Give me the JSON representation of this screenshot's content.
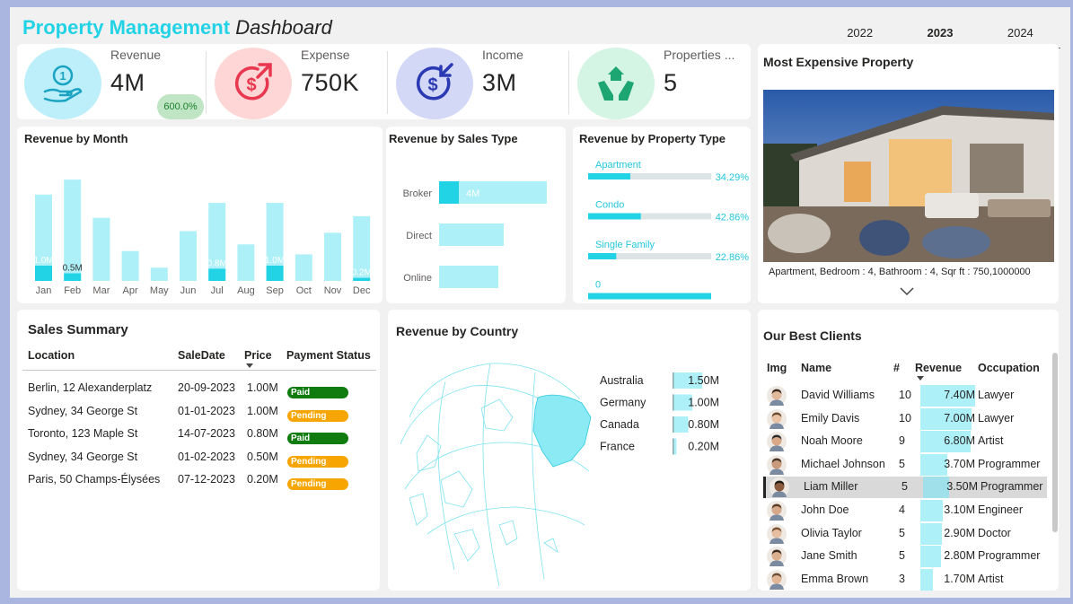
{
  "header": {
    "title_part1": "Property Management",
    "title_part2": "Dashboard"
  },
  "year_tabs": [
    {
      "label": "2022",
      "active": false
    },
    {
      "label": "2023",
      "active": true
    },
    {
      "label": "2024",
      "active": false
    }
  ],
  "kpis": {
    "revenue": {
      "label": "Revenue",
      "value": "4M",
      "badge": "600.0%",
      "icon": "hand-coin-icon",
      "color": "#bdeffa"
    },
    "expense": {
      "label": "Expense",
      "value": "750K",
      "icon": "dollar-arrow-out-icon",
      "color": "#ffd6d6"
    },
    "income": {
      "label": "Income",
      "value": "3M",
      "icon": "dollar-arrow-in-icon",
      "color": "#d4d8f7"
    },
    "properties": {
      "label": "Properties ...",
      "value": "5",
      "icon": "hand-house-icon",
      "color": "#d4f5e4"
    }
  },
  "revenue_by_month": {
    "title": "Revenue by Month",
    "data_labels": [
      "1.0M",
      "0.5M",
      "0.8M",
      "1.0M",
      "0.2M"
    ],
    "chart_data": {
      "type": "bar",
      "categories": [
        "Jan",
        "Feb",
        "Mar",
        "Apr",
        "May",
        "Jun",
        "Jul",
        "Aug",
        "Sep",
        "Oct",
        "Nov",
        "Dec"
      ],
      "series": [
        {
          "values": [
            1.0,
            0.5,
            0,
            0,
            0,
            0,
            0.8,
            0,
            1.0,
            0,
            0,
            0.2
          ]
        },
        {
          "values": [
            5.2,
            6.1,
            3.8,
            1.8,
            0.8,
            3.0,
            4.7,
            2.2,
            4.7,
            1.6,
            2.9,
            3.9
          ]
        }
      ]
    }
  },
  "revenue_by_sales_type": {
    "title": "Revenue by Sales Type",
    "chart_data": {
      "type": "bar",
      "categories": [
        "Broker",
        "Direct",
        "Online"
      ],
      "values": [
        4,
        2.4,
        2.2
      ],
      "data_labels": [
        "4M",
        "",
        ""
      ]
    }
  },
  "revenue_by_property_type": {
    "title": "Revenue by Property Type",
    "items": [
      {
        "label": "Apartment",
        "pct": "34.29%",
        "fraction": 0.3429
      },
      {
        "label": "Condo",
        "pct": "42.86%",
        "fraction": 0.4286
      },
      {
        "label": "Single Family",
        "pct": "22.86%",
        "fraction": 0.2286
      },
      {
        "label": "0",
        "pct": "",
        "fraction": 1.0
      }
    ]
  },
  "most_expensive": {
    "title": "Most Expensive Property",
    "caption": "Apartment, Bedroom : 4, Bathroom : 4, Sqr ft : 750,1000000"
  },
  "sales_summary": {
    "title": "Sales Summary",
    "columns": [
      "Location",
      "SaleDate",
      "Price",
      "Payment Status"
    ],
    "rows": [
      {
        "location": "Berlin, 12 Alexanderplatz",
        "date": "20-09-2023",
        "price": "1.00M",
        "status": "Paid"
      },
      {
        "location": "Sydney, 34 George St",
        "date": "01-01-2023",
        "price": "1.00M",
        "status": "Pending"
      },
      {
        "location": "Toronto, 123 Maple St",
        "date": "14-07-2023",
        "price": "0.80M",
        "status": "Paid"
      },
      {
        "location": "Sydney, 34 George St",
        "date": "01-02-2023",
        "price": "0.50M",
        "status": "Pending"
      },
      {
        "location": "Paris, 50 Champs-Élysées",
        "date": "07-12-2023",
        "price": "0.20M",
        "status": "Pending"
      }
    ],
    "status_colors": {
      "Paid": "#107c10",
      "Pending": "#f7a500"
    }
  },
  "revenue_by_country": {
    "title": "Revenue by Country",
    "chart_data": {
      "type": "bar",
      "categories": [
        "Australia",
        "Germany",
        "Canada",
        "France"
      ],
      "values": [
        1.5,
        1.0,
        0.8,
        0.2
      ],
      "data_labels": [
        "1.50M",
        "1.00M",
        "0.80M",
        "0.20M"
      ]
    }
  },
  "best_clients": {
    "title": "Our Best Clients",
    "columns": [
      "Img",
      "Name",
      "#",
      "Revenue",
      "Occupation"
    ],
    "rows": [
      {
        "name": "David Williams",
        "count": "10",
        "revenue": "7.40M",
        "value": 7.4,
        "occupation": "Lawyer"
      },
      {
        "name": "Emily Davis",
        "count": "10",
        "revenue": "7.00M",
        "value": 7.0,
        "occupation": "Lawyer"
      },
      {
        "name": "Noah Moore",
        "count": "9",
        "revenue": "6.80M",
        "value": 6.8,
        "occupation": "Artist"
      },
      {
        "name": "Michael Johnson",
        "count": "5",
        "revenue": "3.70M",
        "value": 3.7,
        "occupation": "Programmer"
      },
      {
        "name": "Liam Miller",
        "count": "5",
        "revenue": "3.50M",
        "value": 3.5,
        "occupation": "Programmer",
        "selected": true
      },
      {
        "name": "John Doe",
        "count": "4",
        "revenue": "3.10M",
        "value": 3.1,
        "occupation": "Engineer"
      },
      {
        "name": "Olivia Taylor",
        "count": "5",
        "revenue": "2.90M",
        "value": 2.9,
        "occupation": "Doctor"
      },
      {
        "name": "Jane Smith",
        "count": "5",
        "revenue": "2.80M",
        "value": 2.8,
        "occupation": "Programmer"
      },
      {
        "name": "Emma Brown",
        "count": "3",
        "revenue": "1.70M",
        "value": 1.7,
        "occupation": "Artist"
      }
    ]
  }
}
